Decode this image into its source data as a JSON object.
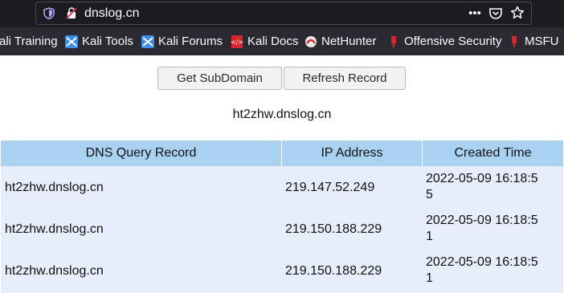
{
  "browser": {
    "url": "dnslog.cn",
    "bookmarks": [
      {
        "label": "ali Training",
        "icon": "kali-icon"
      },
      {
        "label": "Kali Tools",
        "icon": "kali-icon"
      },
      {
        "label": "Kali Forums",
        "icon": "kali-icon"
      },
      {
        "label": "Kali Docs",
        "icon": "kali-docs-icon"
      },
      {
        "label": "NetHunter",
        "icon": "nethunter-icon"
      },
      {
        "label": "Offensive Security",
        "icon": "offsec-icon"
      },
      {
        "label": "MSFU",
        "icon": "offsec-icon"
      }
    ]
  },
  "page": {
    "get_subdomain_label": "Get SubDomain",
    "refresh_label": "Refresh Record",
    "domain": "ht2zhw.dnslog.cn",
    "table": {
      "headers": [
        "DNS Query Record",
        "IP Address",
        "Created Time"
      ],
      "rows": [
        {
          "record": "ht2zhw.dnslog.cn",
          "ip": "219.147.52.249",
          "time_line1": "2022-05-09 16:18:5",
          "time_line2": "5"
        },
        {
          "record": "ht2zhw.dnslog.cn",
          "ip": "219.150.188.229",
          "time_line1": "2022-05-09 16:18:5",
          "time_line2": "1"
        },
        {
          "record": "ht2zhw.dnslog.cn",
          "ip": "219.150.188.229",
          "time_line1": "2022-05-09 16:18:5",
          "time_line2": "1"
        }
      ]
    }
  },
  "colors": {
    "toolbar": "#1c1b22",
    "bookmarks_bar": "#2b2a33",
    "table_header": "#a9d1f0",
    "table_row": "#e6eefb"
  }
}
